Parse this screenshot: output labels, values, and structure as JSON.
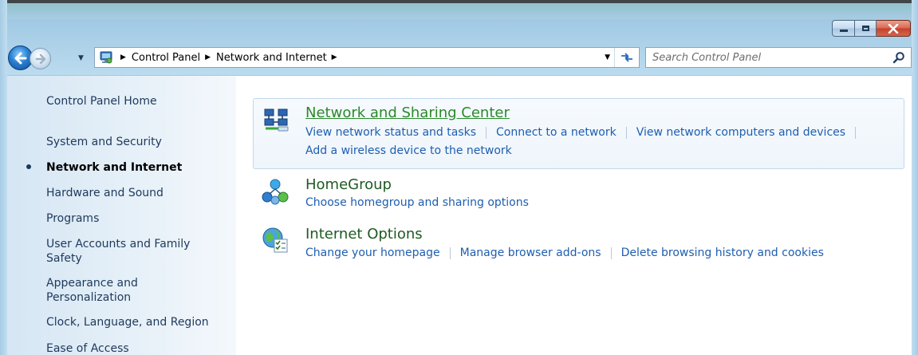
{
  "window": {
    "colors": {
      "accent": "#1e5eb0",
      "title_green": "#1e5a24",
      "hover_green": "#2a8a2a",
      "close_red": "#c7402a"
    }
  },
  "navbar": {
    "breadcrumbs": [
      "Control Panel",
      "Network and Internet"
    ],
    "search_placeholder": "Search Control Panel",
    "icons": {
      "back": "arrow-left-icon",
      "forward": "arrow-right-icon",
      "refresh": "refresh-icon",
      "search": "search-icon"
    }
  },
  "sidebar": {
    "items": [
      {
        "label": "Control Panel Home"
      },
      {
        "label": "System and Security"
      },
      {
        "label": "Network and Internet",
        "current": true
      },
      {
        "label": "Hardware and Sound"
      },
      {
        "label": "Programs"
      },
      {
        "label": "User Accounts and Family Safety"
      },
      {
        "label": "Appearance and Personalization"
      },
      {
        "label": "Clock, Language, and Region"
      },
      {
        "label": "Ease of Access"
      }
    ]
  },
  "main": {
    "sections": [
      {
        "title": "Network and Sharing Center",
        "icon": "network-icon",
        "links": [
          "View network status and tasks",
          "Connect to a network",
          "View network computers and devices",
          "Add a wireless device to the network"
        ]
      },
      {
        "title": "HomeGroup",
        "icon": "homegroup-icon",
        "links": [
          "Choose homegroup and sharing options"
        ]
      },
      {
        "title": "Internet Options",
        "icon": "internet-options-icon",
        "links": [
          "Change your homepage",
          "Manage browser add-ons",
          "Delete browsing history and cookies"
        ]
      }
    ]
  }
}
